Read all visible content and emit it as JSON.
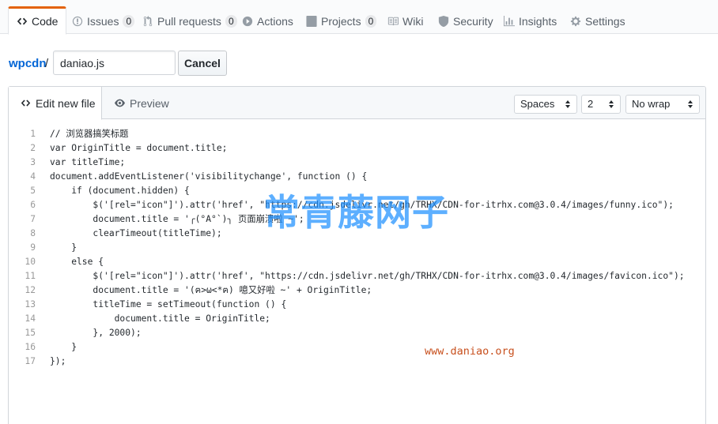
{
  "repo_nav": {
    "tabs": [
      {
        "label": "Code",
        "icon": "code-icon",
        "selected": true
      },
      {
        "label": "Issues",
        "icon": "issue-icon",
        "count": "0"
      },
      {
        "label": "Pull requests",
        "icon": "pull-request-icon",
        "count": "0"
      },
      {
        "label": "Actions",
        "icon": "play-icon"
      },
      {
        "label": "Projects",
        "icon": "project-icon",
        "count": "0"
      },
      {
        "label": "Wiki",
        "icon": "book-icon"
      },
      {
        "label": "Security",
        "icon": "shield-icon"
      },
      {
        "label": "Insights",
        "icon": "graph-icon"
      },
      {
        "label": "Settings",
        "icon": "gear-icon"
      }
    ]
  },
  "breadcrumb": {
    "owner": "wpcdn",
    "separator": "/",
    "filename_value": "daniao.js",
    "cancel_label": "Cancel"
  },
  "editor": {
    "tabs": [
      {
        "label": "Edit new file",
        "icon": "code-icon",
        "active": true
      },
      {
        "label": "Preview",
        "icon": "eye-icon",
        "active": false
      }
    ],
    "indent_mode": "Spaces",
    "indent_size": "2",
    "wrap_mode": "No wrap",
    "lines": [
      {
        "n": "1",
        "text": "// 浏览器搞笑标题"
      },
      {
        "n": "2",
        "text": "var OriginTitle = document.title;"
      },
      {
        "n": "3",
        "text": "var titleTime;"
      },
      {
        "n": "4",
        "text": "document.addEventListener('visibilitychange', function () {"
      },
      {
        "n": "5",
        "text": "    if (document.hidden) {"
      },
      {
        "n": "6",
        "text": "        $('[rel=\"icon\"]').attr('href', \"https://cdn.jsdelivr.net/gh/TRHX/CDN-for-itrhx.com@3.0.4/images/funny.ico\");"
      },
      {
        "n": "7",
        "text": "        document.title = '╭(°A°`)╮ 页面崩溃啦 ~';"
      },
      {
        "n": "8",
        "text": "        clearTimeout(titleTime);"
      },
      {
        "n": "9",
        "text": "    }"
      },
      {
        "n": "10",
        "text": "    else {"
      },
      {
        "n": "11",
        "text": "        $('[rel=\"icon\"]').attr('href', \"https://cdn.jsdelivr.net/gh/TRHX/CDN-for-itrhx.com@3.0.4/images/favicon.ico\");"
      },
      {
        "n": "12",
        "text": "        document.title = '(ฅ>ω<*ฅ) 噫又好啦 ~' + OriginTitle;"
      },
      {
        "n": "13",
        "text": "        titleTime = setTimeout(function () {"
      },
      {
        "n": "14",
        "text": "            document.title = OriginTitle;"
      },
      {
        "n": "15",
        "text": "        }, 2000);"
      },
      {
        "n": "16",
        "text": "    }"
      },
      {
        "n": "17",
        "text": "});"
      }
    ]
  },
  "watermark": {
    "text": "常青藤网子",
    "url": "www.daniao.org"
  },
  "colors": {
    "selected_tab_accent": "#e36209",
    "link": "#0366d6",
    "watermark_blue": "#1e90ff",
    "watermark_url": "#c8501e"
  }
}
